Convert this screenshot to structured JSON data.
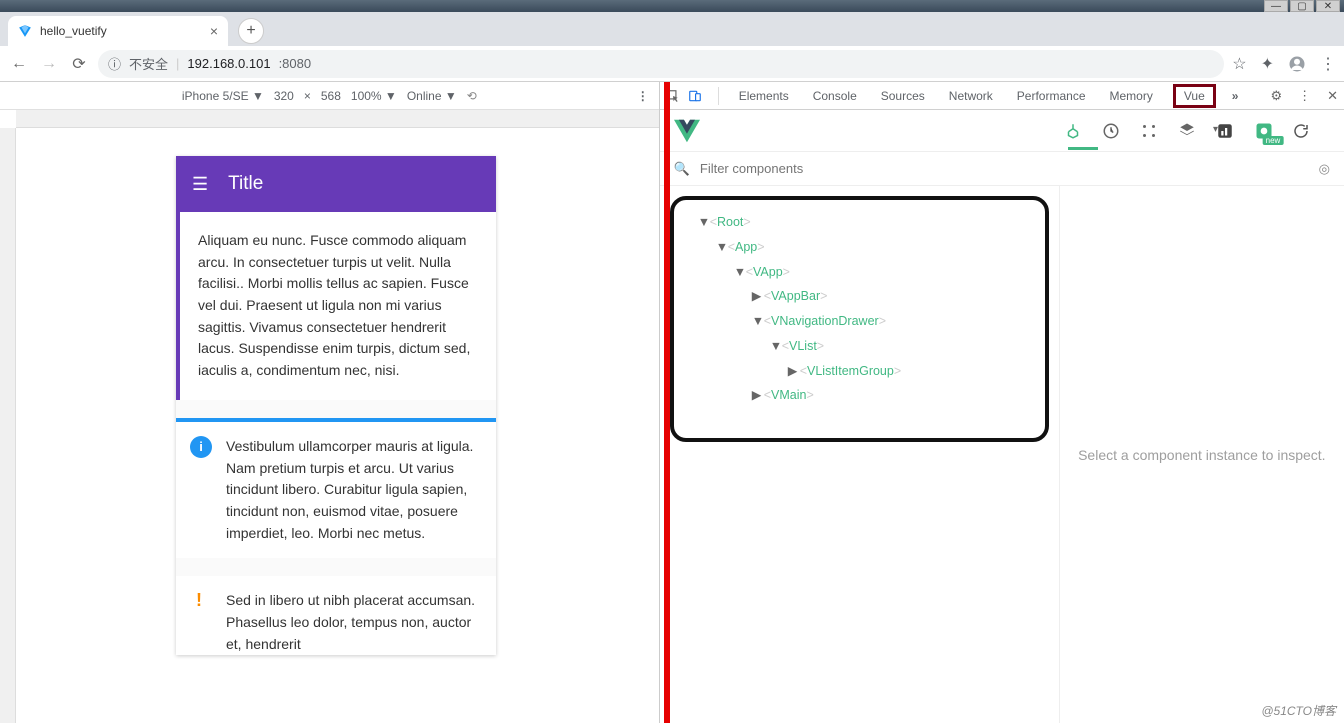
{
  "window": {
    "min": "—",
    "max": "▢",
    "close": "✕"
  },
  "browser": {
    "tab_title": "hello_vuetify",
    "address_info": "ⓘ",
    "address_danger": "不安全",
    "address_url": "192.168.0.101",
    "address_port": ":8080"
  },
  "device_toolbar": {
    "device": "iPhone 5/SE ▼",
    "w": "320",
    "x": "×",
    "h": "568",
    "zoom": "100% ▼",
    "online": "Online ▼"
  },
  "preview": {
    "title": "Title",
    "card1": "Aliquam eu nunc. Fusce commodo aliquam arcu. In consectetuer turpis ut velit. Nulla facilisi.. Morbi mollis tellus ac sapien. Fusce vel dui. Praesent ut ligula non mi varius sagittis. Vivamus consectetuer hendrerit lacus. Suspendisse enim turpis, dictum sed, iaculis a, condimentum nec, nisi.",
    "card2": "Vestibulum ullamcorper mauris at ligula. Nam pretium turpis et arcu. Ut varius tincidunt libero. Curabitur ligula sapien, tincidunt non, euismod vitae, posuere imperdiet, leo. Morbi nec metus.",
    "card3": "Sed in libero ut nibh placerat accumsan. Phasellus leo dolor, tempus non, auctor et, hendrerit"
  },
  "devtools": {
    "tabs": [
      "Elements",
      "Console",
      "Sources",
      "Network",
      "Performance",
      "Memory"
    ],
    "vue": "Vue",
    "more": "»"
  },
  "vuetools": {
    "filter_placeholder": "Filter components",
    "badge_new": "new",
    "detail_empty": "Select a component instance to inspect.",
    "tree": {
      "root": "Root",
      "app": "App",
      "vapp": "VApp",
      "vappbar": "VAppBar",
      "vnav": "VNavigationDrawer",
      "vlist": "VList",
      "vlistitemgroup": "VListItemGroup",
      "vmain": "VMain"
    }
  },
  "watermark": "@51CTO博客"
}
